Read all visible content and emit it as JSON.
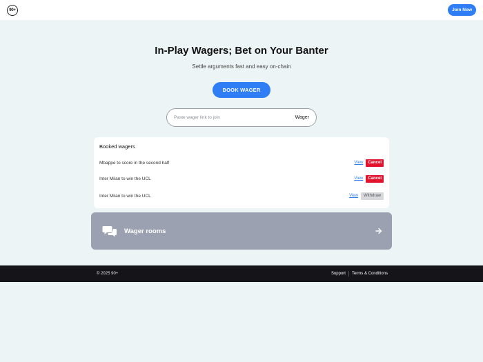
{
  "header": {
    "logo_text": "90+",
    "join_label": "Join Now"
  },
  "hero": {
    "title": "In-Play Wagers; Bet on Your Banter",
    "subtitle": "Settle arguments fast and easy on-chain",
    "book_label": "BOOK WAGER"
  },
  "join": {
    "placeholder": "Paste wager link to join",
    "value": "",
    "button_label": "Wager"
  },
  "booked": {
    "title": "Booked wagers",
    "rows": [
      {
        "text": "Mbappe to score in the second half",
        "view_label": "View",
        "action_label": "Cancel",
        "action_type": "cancel"
      },
      {
        "text": "Inter Milan to win the UCL",
        "view_label": "View",
        "action_label": "Cancel",
        "action_type": "cancel"
      },
      {
        "text": "Inter Milan to win the UCL",
        "view_label": "View",
        "action_label": "Withdraw",
        "action_type": "withdraw"
      }
    ]
  },
  "rooms": {
    "label": "Wager rooms",
    "icon": "chat-bubbles-icon",
    "arrow_icon": "arrow-right-icon"
  },
  "footer": {
    "copyright": "© 2025 90+",
    "links": [
      "Support",
      "Terms & Conditions"
    ]
  },
  "colors": {
    "accent": "#2f7ef5",
    "danger": "#e3122d",
    "rooms_bg": "#9ba1b0",
    "footer_bg": "#141419",
    "page_bg": "#edf4f5"
  }
}
